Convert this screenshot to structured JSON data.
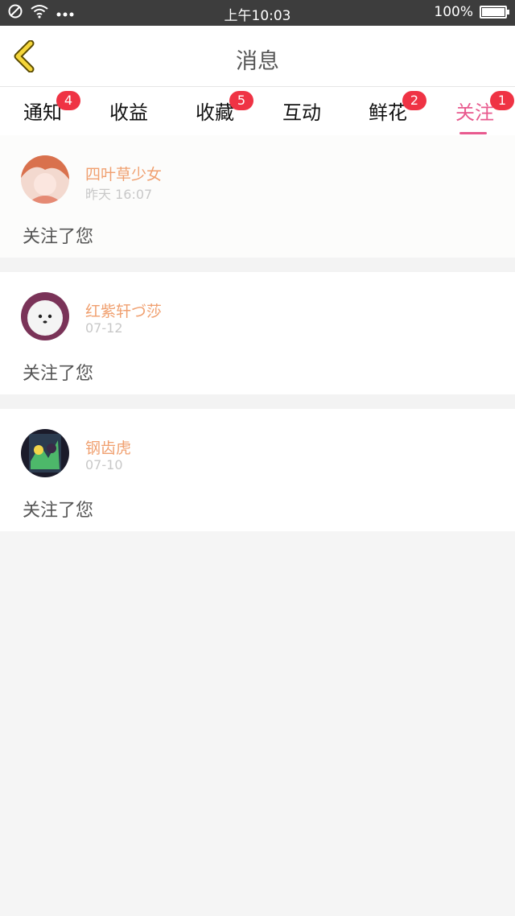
{
  "status_bar": {
    "time": "上午10:03",
    "battery": "100%",
    "icons": [
      "no-disturb-icon",
      "wifi-icon",
      "more-dots-icon",
      "battery-icon"
    ]
  },
  "header": {
    "title": "消息",
    "back_icon": "chevron-left-icon"
  },
  "tabs": [
    {
      "label": "通知",
      "badge": "4"
    },
    {
      "label": "收益",
      "badge": ""
    },
    {
      "label": "收藏",
      "badge": "5"
    },
    {
      "label": "互动",
      "badge": ""
    },
    {
      "label": "鲜花",
      "badge": "2"
    },
    {
      "label": "关注",
      "badge": "1",
      "active": true
    }
  ],
  "messages": [
    {
      "name": "四叶草少女",
      "time": "昨天 16:07",
      "text": "关注了您"
    },
    {
      "name": "红紫轩づ莎",
      "time": "07-12",
      "text": "关注了您"
    },
    {
      "name": "钢齿虎",
      "time": "07-10",
      "text": "关注了您"
    }
  ],
  "colors": {
    "accent": "#e85a8e",
    "badge": "#ef3344",
    "username": "#f0a070",
    "statusbar": "#3d3d3d"
  }
}
